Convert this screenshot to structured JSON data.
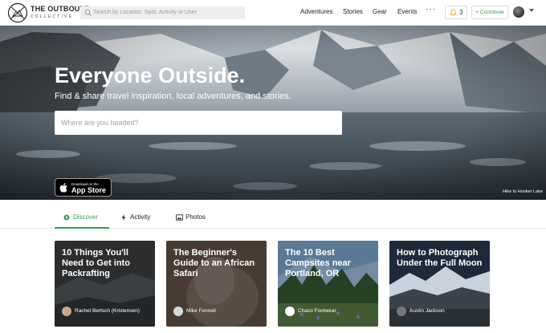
{
  "brand": {
    "title": "THE OUTBOUND",
    "subtitle": "COLLECTIVE"
  },
  "header": {
    "search_placeholder": "Search by Location, Spot, Activity or User",
    "nav": [
      "Adventures",
      "Stories",
      "Gear",
      "Events"
    ],
    "more_label": "···",
    "notification_count": "3",
    "contribute_label": "+ Contribute"
  },
  "hero": {
    "title": "Everyone Outside.",
    "subtitle": "Find & share travel inspiration, local adventures, and stories.",
    "search_placeholder": "Where are you headed?",
    "appstore_small": "Download on the",
    "appstore_big": "App Store",
    "caption": "Hike to Hooker Lake"
  },
  "tabs": [
    {
      "label": "Discover",
      "icon": "compass-icon",
      "active": true
    },
    {
      "label": "Activity",
      "icon": "bolt-icon",
      "active": false
    },
    {
      "label": "Photos",
      "icon": "image-icon",
      "active": false
    }
  ],
  "cards": [
    {
      "title": "10 Things You'll Need to Get into Packrafting",
      "author": "Rachel Bertsch (Kristensen)"
    },
    {
      "title": "The Beginner's Guide to an African Safari",
      "author": "Mike Fennell"
    },
    {
      "title": "The 10 Best Campsites near Portland, OR",
      "author": "Chaco Footwear"
    },
    {
      "title": "How to Photograph Under the Full Moon",
      "author": "Austin Jackson"
    }
  ],
  "colors": {
    "accent": "#3a9b58",
    "notification": "#f5a623"
  }
}
